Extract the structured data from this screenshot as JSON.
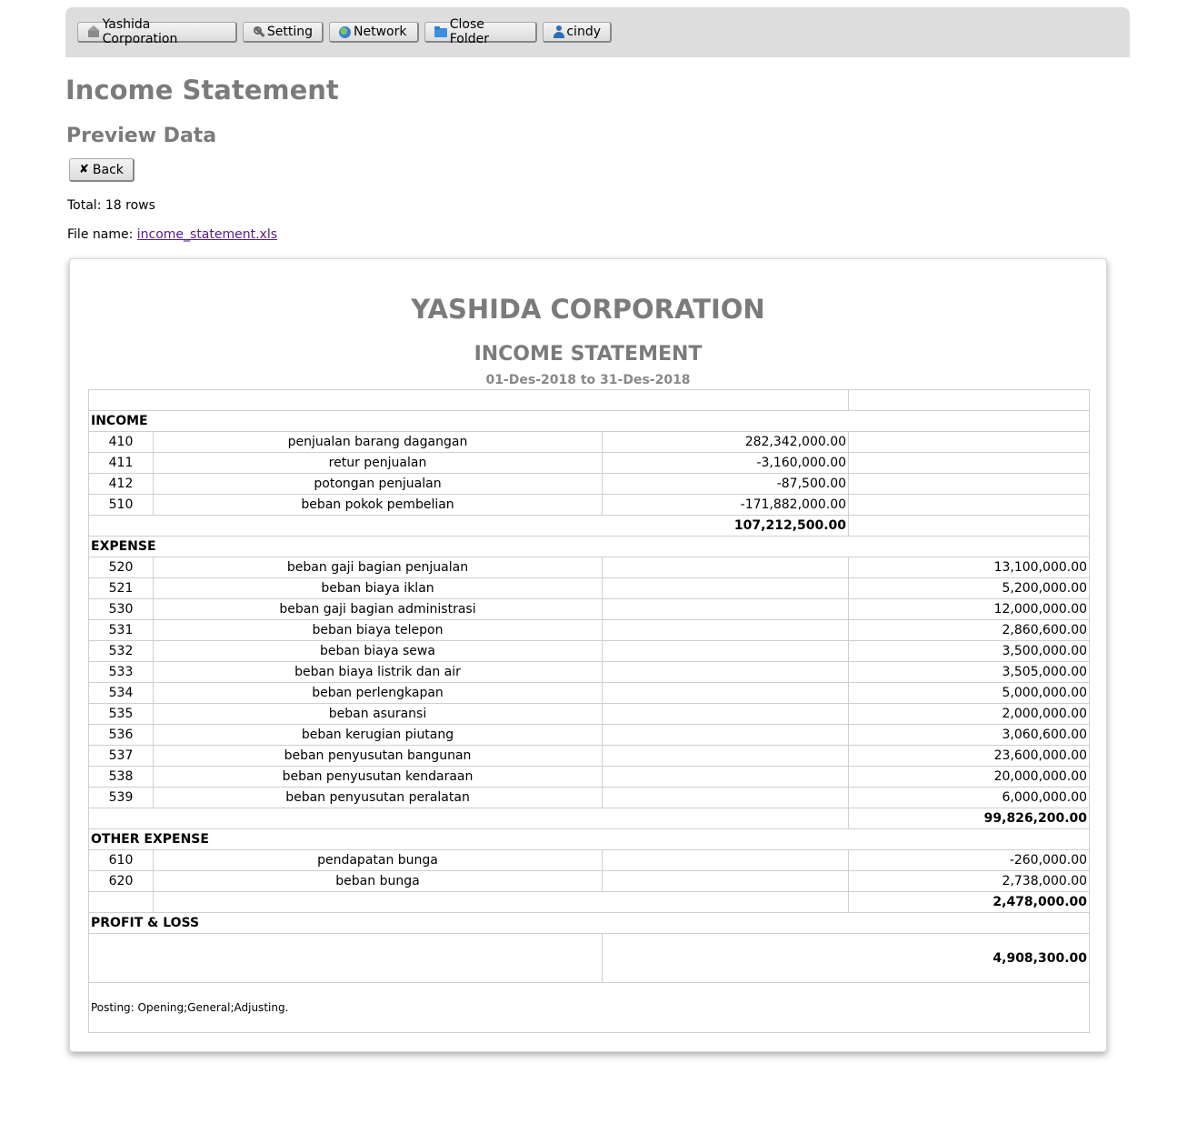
{
  "nav": {
    "company": "Yashida Corporation",
    "setting": "Setting",
    "network": "Network",
    "close_folder": "Close Folder",
    "user": "cindy"
  },
  "page": {
    "title": "Income Statement",
    "subtitle": "Preview Data",
    "back_label": "Back",
    "total_label": "Total: 18 rows",
    "file_label": "File name:",
    "file_name": "income_statement.xls"
  },
  "report": {
    "company": "YASHIDA CORPORATION",
    "title": "INCOME STATEMENT",
    "period": "01-Des-2018 to 31-Des-2018",
    "income": {
      "label": "INCOME",
      "rows": [
        {
          "code": "410",
          "name": "penjualan barang dagangan",
          "amount": "282,342,000.00"
        },
        {
          "code": "411",
          "name": "retur penjualan",
          "amount": "-3,160,000.00"
        },
        {
          "code": "412",
          "name": "potongan penjualan",
          "amount": "-87,500.00"
        },
        {
          "code": "510",
          "name": "beban pokok pembelian",
          "amount": "-171,882,000.00"
        }
      ],
      "total": "107,212,500.00"
    },
    "expense": {
      "label": "EXPENSE",
      "rows": [
        {
          "code": "520",
          "name": "beban gaji bagian penjualan",
          "amount": "13,100,000.00"
        },
        {
          "code": "521",
          "name": "beban biaya iklan",
          "amount": "5,200,000.00"
        },
        {
          "code": "530",
          "name": "beban gaji bagian administrasi",
          "amount": "12,000,000.00"
        },
        {
          "code": "531",
          "name": "beban biaya telepon",
          "amount": "2,860,600.00"
        },
        {
          "code": "532",
          "name": "beban biaya sewa",
          "amount": "3,500,000.00"
        },
        {
          "code": "533",
          "name": "beban biaya listrik dan air",
          "amount": "3,505,000.00"
        },
        {
          "code": "534",
          "name": "beban perlengkapan",
          "amount": "5,000,000.00"
        },
        {
          "code": "535",
          "name": "beban asuransi",
          "amount": "2,000,000.00"
        },
        {
          "code": "536",
          "name": "beban kerugian piutang",
          "amount": "3,060,600.00"
        },
        {
          "code": "537",
          "name": "beban penyusutan bangunan",
          "amount": "23,600,000.00"
        },
        {
          "code": "538",
          "name": "beban penyusutan kendaraan",
          "amount": "20,000,000.00"
        },
        {
          "code": "539",
          "name": "beban penyusutan peralatan",
          "amount": "6,000,000.00"
        }
      ],
      "total": "99,826,200.00"
    },
    "other_expense": {
      "label": "OTHER EXPENSE",
      "rows": [
        {
          "code": "610",
          "name": "pendapatan bunga",
          "amount": "-260,000.00"
        },
        {
          "code": "620",
          "name": "beban bunga",
          "amount": "2,738,000.00"
        }
      ],
      "total": "2,478,000.00"
    },
    "profit_loss": {
      "label": "PROFIT & LOSS",
      "value": "4,908,300.00"
    },
    "posting": "Posting: Opening;General;Adjusting."
  }
}
